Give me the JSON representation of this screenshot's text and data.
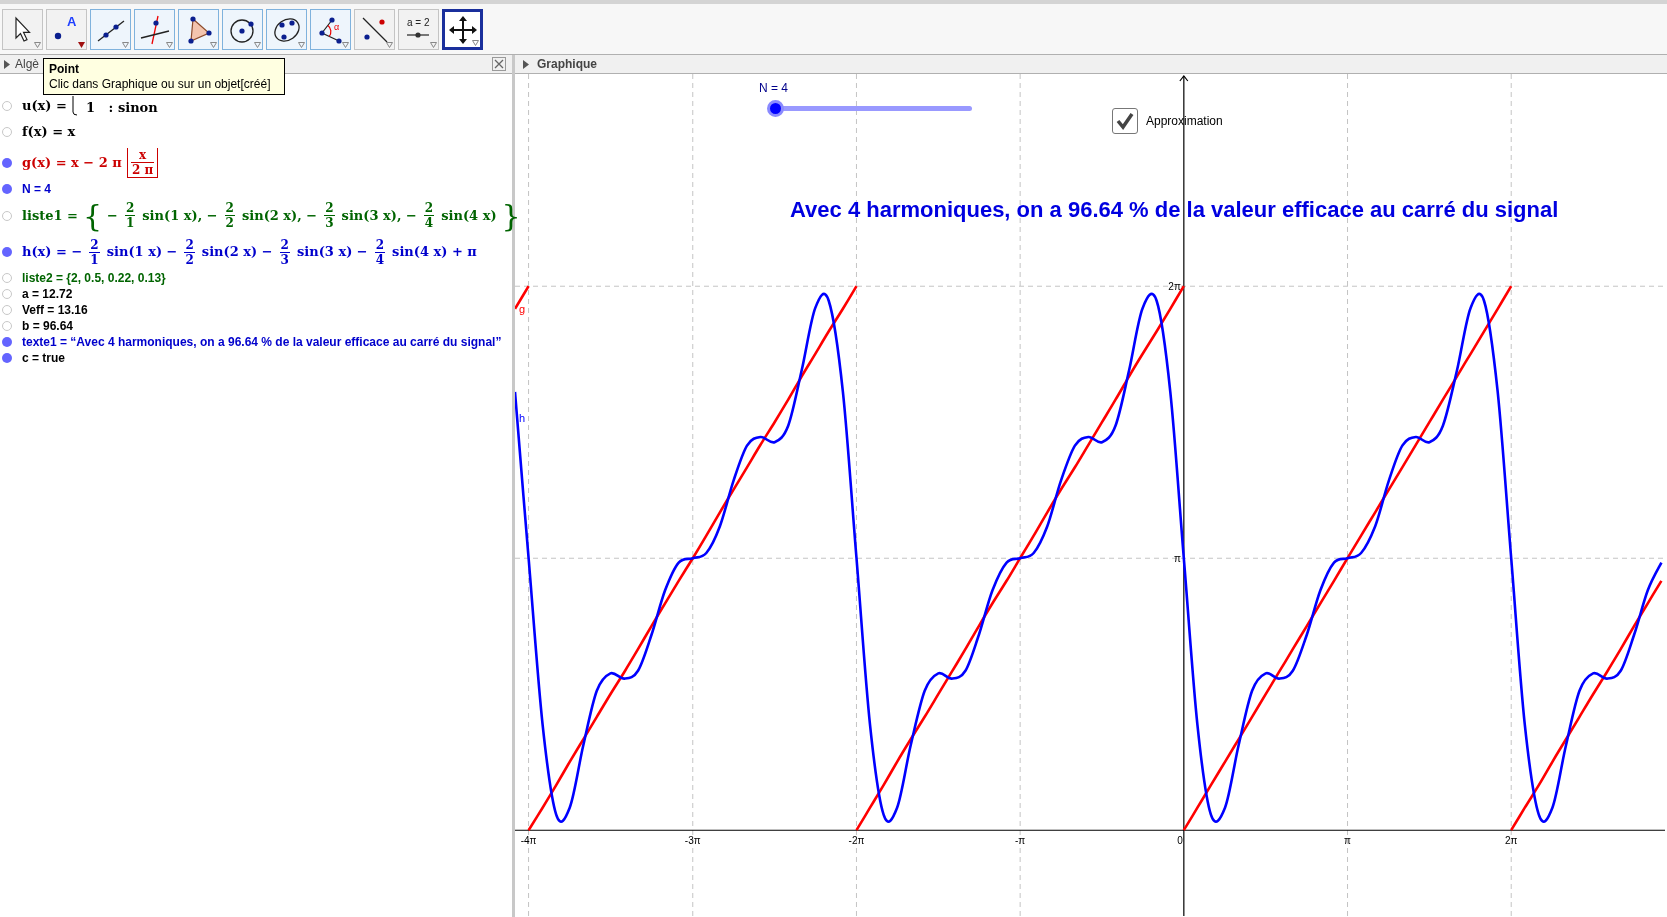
{
  "toolbar": {
    "tools": [
      {
        "kind": "move",
        "selected": false,
        "highlighted": false,
        "hovered": false
      },
      {
        "kind": "point",
        "label": "A",
        "selected": false,
        "highlighted": false,
        "hovered": true
      },
      {
        "kind": "line",
        "selected": false,
        "highlighted": true,
        "hovered": false
      },
      {
        "kind": "perpendicular",
        "selected": false,
        "highlighted": true,
        "hovered": false
      },
      {
        "kind": "polygon",
        "selected": false,
        "highlighted": true,
        "hovered": false
      },
      {
        "kind": "circle",
        "selected": false,
        "highlighted": true,
        "hovered": false
      },
      {
        "kind": "conic",
        "selected": false,
        "highlighted": true,
        "hovered": false
      },
      {
        "kind": "angle",
        "label": "α",
        "selected": false,
        "highlighted": true,
        "hovered": false
      },
      {
        "kind": "reflect",
        "selected": false,
        "highlighted": false,
        "hovered": false
      },
      {
        "kind": "slider",
        "label": "a = 2",
        "selected": false,
        "highlighted": false,
        "hovered": false
      },
      {
        "kind": "move_view",
        "selected": true,
        "highlighted": false,
        "hovered": false
      }
    ]
  },
  "tooltip": {
    "title": "Point",
    "text": "Clic dans Graphique ou sur un objet[créé]"
  },
  "algebra_view": {
    "title": "Algè",
    "rows": [
      {
        "kind": "formula",
        "visible": false,
        "color": "#000000",
        "parts": [
          {
            "kind": "text",
            "text": "u(x) ="
          },
          {
            "kind": "case",
            "text": "1   : sinon"
          }
        ]
      },
      {
        "kind": "formula",
        "visible": false,
        "color": "#000000",
        "parts": [
          {
            "kind": "text",
            "text": "f(x) = x"
          }
        ]
      },
      {
        "kind": "formula",
        "visible": true,
        "color": "#cc0000",
        "parts": [
          {
            "kind": "text",
            "text": "g(x) = x − 2 π"
          },
          {
            "kind": "frac",
            "num": "x",
            "den": "2 π",
            "floor": true
          }
        ]
      },
      {
        "kind": "plain",
        "visible": true,
        "color": "#0000cc",
        "text": "N = 4"
      },
      {
        "kind": "formula",
        "visible": false,
        "color": "#006400",
        "parts": [
          {
            "kind": "text",
            "text": "liste1 ="
          },
          {
            "kind": "open",
            "text": "{"
          },
          {
            "kind": "text",
            "text": "−"
          },
          {
            "kind": "frac",
            "num": "2",
            "den": "1"
          },
          {
            "kind": "text",
            "text": "sin(1 x), −"
          },
          {
            "kind": "frac",
            "num": "2",
            "den": "2"
          },
          {
            "kind": "text",
            "text": "sin(2 x), −"
          },
          {
            "kind": "frac",
            "num": "2",
            "den": "3"
          },
          {
            "kind": "text",
            "text": "sin(3 x), −"
          },
          {
            "kind": "frac",
            "num": "2",
            "den": "4"
          },
          {
            "kind": "text",
            "text": "sin(4 x)"
          },
          {
            "kind": "close",
            "text": "}"
          }
        ]
      },
      {
        "kind": "formula",
        "visible": true,
        "color": "#0000cc",
        "parts": [
          {
            "kind": "text",
            "text": "h(x) = −"
          },
          {
            "kind": "frac",
            "num": "2",
            "den": "1"
          },
          {
            "kind": "text",
            "text": "sin(1 x) −"
          },
          {
            "kind": "frac",
            "num": "2",
            "den": "2"
          },
          {
            "kind": "text",
            "text": "sin(2 x) −"
          },
          {
            "kind": "frac",
            "num": "2",
            "den": "3"
          },
          {
            "kind": "text",
            "text": "sin(3 x) −"
          },
          {
            "kind": "frac",
            "num": "2",
            "den": "4"
          },
          {
            "kind": "text",
            "text": "sin(4 x) + π"
          }
        ]
      },
      {
        "kind": "plain",
        "visible": false,
        "color": "#006400",
        "text": "liste2 = {2, 0.5, 0.22, 0.13}"
      },
      {
        "kind": "plain",
        "visible": false,
        "color": "#000000",
        "text": "a = 12.72"
      },
      {
        "kind": "plain",
        "visible": false,
        "color": "#000000",
        "text": "Veff = 13.16"
      },
      {
        "kind": "plain",
        "visible": false,
        "color": "#000000",
        "text": "b = 96.64"
      },
      {
        "kind": "plain",
        "visible": true,
        "color": "#0000cc",
        "text": "texte1 = “Avec 4 harmoniques, on a 96.64 % de la valeur efficace au carré du signal”"
      },
      {
        "kind": "plain",
        "visible": true,
        "color": "#000000",
        "text": "c = true"
      }
    ]
  },
  "graphics_view": {
    "title": "Graphique",
    "slider": {
      "label": "N = 4",
      "level": 0
    },
    "checkbox": {
      "label": "Approximation",
      "checked": true
    },
    "text": "Avec 4 harmoniques, on a 96.64 % de la valeur efficace au carré du signal",
    "chart_data": {
      "type": "line",
      "grid": true,
      "xlim": [
        -12.83,
        9.23
      ],
      "ylim": [
        -0.99,
        8.73
      ],
      "xticks": [
        {
          "value": -12.57,
          "label": "-4π"
        },
        {
          "value": -9.42,
          "label": "-3π"
        },
        {
          "value": -6.28,
          "label": "-2π"
        },
        {
          "value": -3.14,
          "label": "-π"
        },
        {
          "value": 0,
          "label": "0"
        },
        {
          "value": 3.14,
          "label": "π"
        },
        {
          "value": 6.28,
          "label": "2π"
        }
      ],
      "yticks": [
        {
          "value": 3.14,
          "label": "π"
        },
        {
          "value": 6.28,
          "label": "2π"
        }
      ],
      "x": [
        -12.83,
        -12.57,
        -12.57,
        -12.3,
        -12.04,
        -11.78,
        -11.52,
        -11.26,
        -11.0,
        -10.73,
        -10.47,
        -10.21,
        -9.95,
        -9.69,
        -9.42,
        -9.16,
        -8.9,
        -8.64,
        -8.38,
        -8.12,
        -7.85,
        -7.59,
        -7.33,
        -7.07,
        -6.81,
        -6.54,
        -6.28,
        -6.28,
        -6.02,
        -5.76,
        -5.5,
        -5.24,
        -4.97,
        -4.71,
        -4.45,
        -4.19,
        -3.93,
        -3.67,
        -3.4,
        -3.14,
        -2.88,
        -2.62,
        -2.36,
        -2.09,
        -1.83,
        -1.57,
        -1.31,
        -1.05,
        -0.79,
        -0.52,
        -0.26,
        0,
        0,
        0.26,
        0.52,
        0.79,
        1.05,
        1.31,
        1.57,
        1.83,
        2.09,
        2.36,
        2.62,
        2.88,
        3.14,
        3.4,
        3.67,
        3.93,
        4.19,
        4.45,
        4.71,
        4.97,
        5.24,
        5.5,
        5.76,
        6.02,
        6.28,
        6.28,
        6.54,
        6.81,
        7.07,
        7.33,
        7.59,
        7.85,
        8.12,
        8.38,
        8.64,
        8.9,
        9.16
      ],
      "series": [
        {
          "name": "g",
          "color": "#ff0000",
          "values": [
            6.02,
            6.28,
            0,
            0.26,
            0.52,
            0.79,
            1.05,
            1.31,
            1.57,
            1.83,
            2.09,
            2.36,
            2.62,
            2.88,
            3.14,
            3.4,
            3.67,
            3.93,
            4.19,
            4.45,
            4.71,
            4.97,
            5.24,
            5.5,
            5.76,
            6.02,
            6.28,
            0,
            0.26,
            0.52,
            0.79,
            1.05,
            1.31,
            1.57,
            1.83,
            2.09,
            2.36,
            2.62,
            2.88,
            3.14,
            3.4,
            3.67,
            3.93,
            4.19,
            4.45,
            4.71,
            4.97,
            5.24,
            5.5,
            5.76,
            6.02,
            6.28,
            0,
            0.26,
            0.52,
            0.79,
            1.05,
            1.31,
            1.57,
            1.83,
            2.09,
            2.36,
            2.62,
            2.88,
            3.14,
            3.4,
            3.67,
            3.93,
            4.19,
            4.45,
            4.71,
            4.97,
            5.24,
            5.5,
            5.76,
            6.02,
            6.28,
            0,
            0.26,
            0.52,
            0.79,
            1.05,
            1.31,
            1.57,
            1.83,
            2.09,
            2.36,
            2.62,
            2.88
          ]
        },
        {
          "name": "h",
          "color": "#0000ff",
          "values": [
            5.06,
            3.14,
            3.14,
            1.22,
            0.18,
            0.26,
            0.98,
            1.61,
            1.81,
            1.75,
            1.84,
            2.26,
            2.77,
            3.09,
            3.14,
            3.2,
            3.51,
            4.03,
            4.44,
            4.54,
            4.48,
            4.67,
            5.31,
            6.03,
            6.11,
            5.06,
            3.14,
            3.14,
            1.22,
            0.18,
            0.26,
            0.98,
            1.61,
            1.81,
            1.75,
            1.84,
            2.26,
            2.77,
            3.09,
            3.14,
            3.2,
            3.51,
            4.03,
            4.44,
            4.54,
            4.48,
            4.67,
            5.31,
            6.03,
            6.11,
            5.06,
            3.14,
            3.14,
            1.22,
            0.18,
            0.26,
            0.98,
            1.61,
            1.81,
            1.75,
            1.84,
            2.26,
            2.77,
            3.09,
            3.14,
            3.2,
            3.51,
            4.03,
            4.44,
            4.54,
            4.48,
            4.67,
            5.31,
            6.03,
            6.11,
            5.06,
            3.14,
            3.14,
            1.22,
            0.18,
            0.26,
            0.98,
            1.61,
            1.81,
            1.75,
            1.84,
            2.26,
            2.77,
            3.09
          ]
        }
      ]
    }
  }
}
